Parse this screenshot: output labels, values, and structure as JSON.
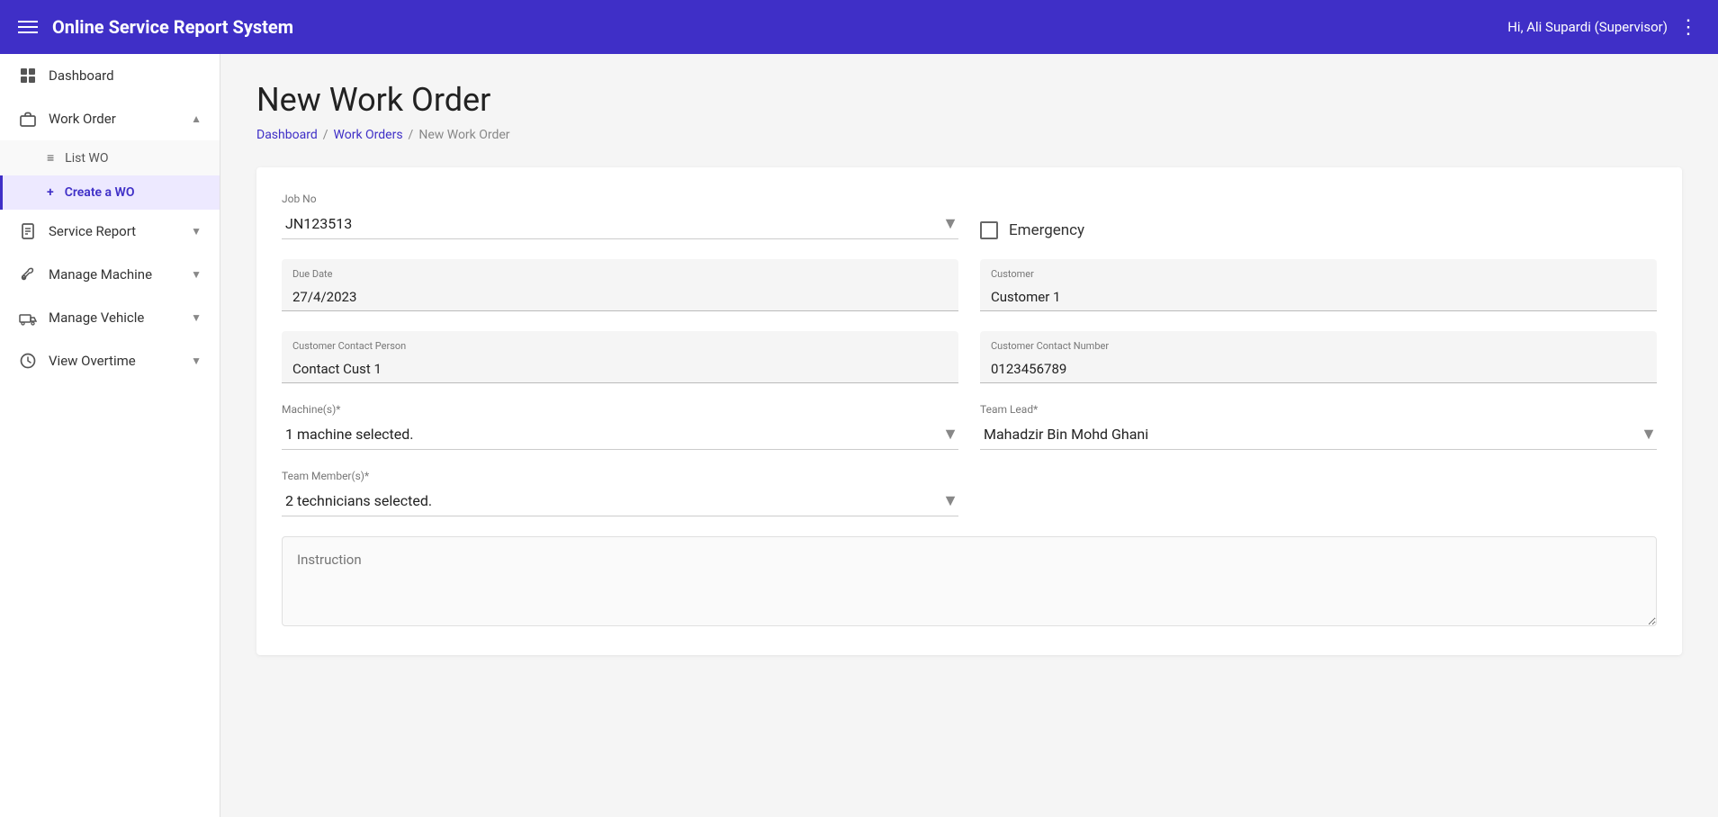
{
  "app": {
    "title": "Online Service Report System",
    "user": "Hi, Ali Supardi (Supervisor)"
  },
  "sidebar": {
    "items": [
      {
        "id": "dashboard",
        "label": "Dashboard",
        "icon": "grid-icon",
        "active": false
      },
      {
        "id": "work-order",
        "label": "Work Order",
        "icon": "briefcase-icon",
        "active": true,
        "expanded": true,
        "children": [
          {
            "id": "list-wo",
            "label": "List WO",
            "active": false
          },
          {
            "id": "create-wo",
            "label": "Create a WO",
            "active": true
          }
        ]
      },
      {
        "id": "service-report",
        "label": "Service Report",
        "icon": "document-icon",
        "active": false,
        "expanded": false
      },
      {
        "id": "manage-machine",
        "label": "Manage Machine",
        "icon": "wrench-icon",
        "active": false,
        "expanded": false
      },
      {
        "id": "manage-vehicle",
        "label": "Manage Vehicle",
        "icon": "truck-icon",
        "active": false,
        "expanded": false
      },
      {
        "id": "view-overtime",
        "label": "View Overtime",
        "icon": "clock-icon",
        "active": false,
        "expanded": false
      }
    ]
  },
  "page": {
    "title": "New Work Order",
    "breadcrumbs": [
      {
        "label": "Dashboard",
        "link": true
      },
      {
        "label": "Work Orders",
        "link": true
      },
      {
        "label": "New Work Order",
        "link": false
      }
    ]
  },
  "form": {
    "job_no_label": "Job No",
    "job_no_value": "JN123513",
    "emergency_label": "Emergency",
    "emergency_checked": false,
    "due_date_label": "Due Date",
    "due_date_value": "27/4/2023",
    "customer_label": "Customer",
    "customer_value": "Customer 1",
    "contact_person_label": "Customer Contact Person",
    "contact_person_value": "Contact Cust 1",
    "contact_number_label": "Customer Contact Number",
    "contact_number_value": "0123456789",
    "machines_label": "Machine(s)*",
    "machines_value": "1 machine selected.",
    "team_lead_label": "Team Lead*",
    "team_lead_value": "Mahadzir Bin Mohd Ghani",
    "team_members_label": "Team Member(s)*",
    "team_members_value": "2 technicians selected.",
    "instruction_placeholder": "Instruction"
  }
}
